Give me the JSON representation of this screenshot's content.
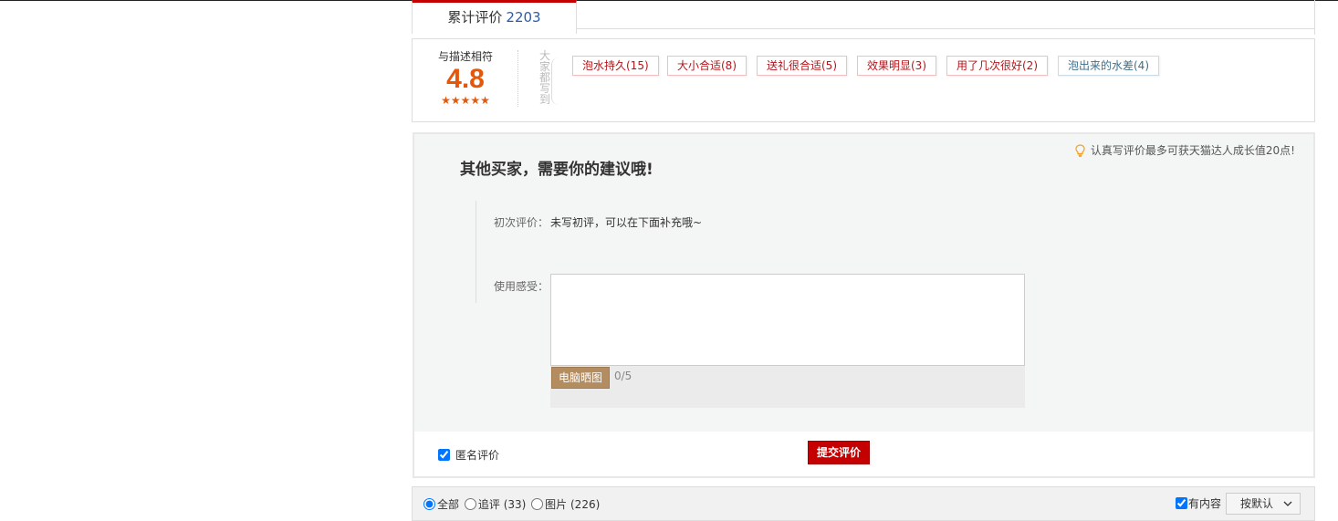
{
  "tab": {
    "label": "累计评价",
    "count": "2203"
  },
  "summary": {
    "score_label": "与描述相符",
    "score": "4.8",
    "stars": "★★★★★",
    "vertical_label": "大家都写到",
    "tags": [
      {
        "text": "泡水持久(15)",
        "sentiment": "positive"
      },
      {
        "text": "大小合适(8)",
        "sentiment": "positive"
      },
      {
        "text": "送礼很合适(5)",
        "sentiment": "positive"
      },
      {
        "text": "效果明显(3)",
        "sentiment": "positive"
      },
      {
        "text": "用了几次很好(2)",
        "sentiment": "positive"
      },
      {
        "text": "泡出来的水差(4)",
        "sentiment": "negative"
      }
    ]
  },
  "feedback": {
    "tip": "认真写评价最多可获天猫达人成长值20点!",
    "title": "其他买家，需要你的建议哦!",
    "first_review_label": "初次评价：",
    "first_review_value": "未写初评，可以在下面补充哦~",
    "usage_label": "使用感受：",
    "usage_value": "",
    "upload_button": "电脑晒图",
    "upload_count": "0/5",
    "anonymous_label": "匿名评价",
    "anonymous_checked": true,
    "submit_label": "提交评价"
  },
  "filter": {
    "options": [
      {
        "label": "全部",
        "count": "",
        "selected": true
      },
      {
        "label": "追评",
        "count": "(33)",
        "selected": false
      },
      {
        "label": "图片",
        "count": "(226)",
        "selected": false
      }
    ],
    "has_content_label": "有内容",
    "has_content_checked": true,
    "sort_label": "按默认"
  },
  "colors": {
    "accent": "#c40000",
    "score": "#e5570a",
    "upload": "#b38c5f",
    "count_link": "#2b5caa"
  }
}
